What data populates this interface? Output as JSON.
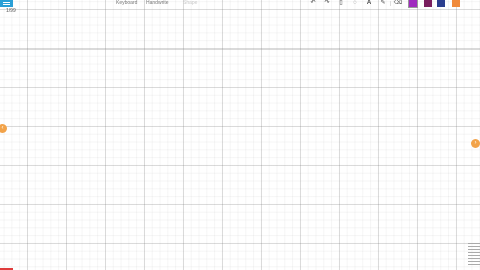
{
  "page": {
    "label": "1/99"
  },
  "modes": [
    {
      "label": "Keyboard"
    },
    {
      "label": "Handwrite"
    },
    {
      "label": "Shape"
    }
  ],
  "toolbar": {
    "tools": [
      "undo-icon",
      "redo-icon",
      "clipboard-icon",
      "lasso-icon",
      "text-icon",
      "pen-icon",
      "eraser-icon"
    ],
    "colors": [
      "#a02bbf",
      "#7a1e5e",
      "#2b3e8e",
      "#f08a3a"
    ]
  }
}
